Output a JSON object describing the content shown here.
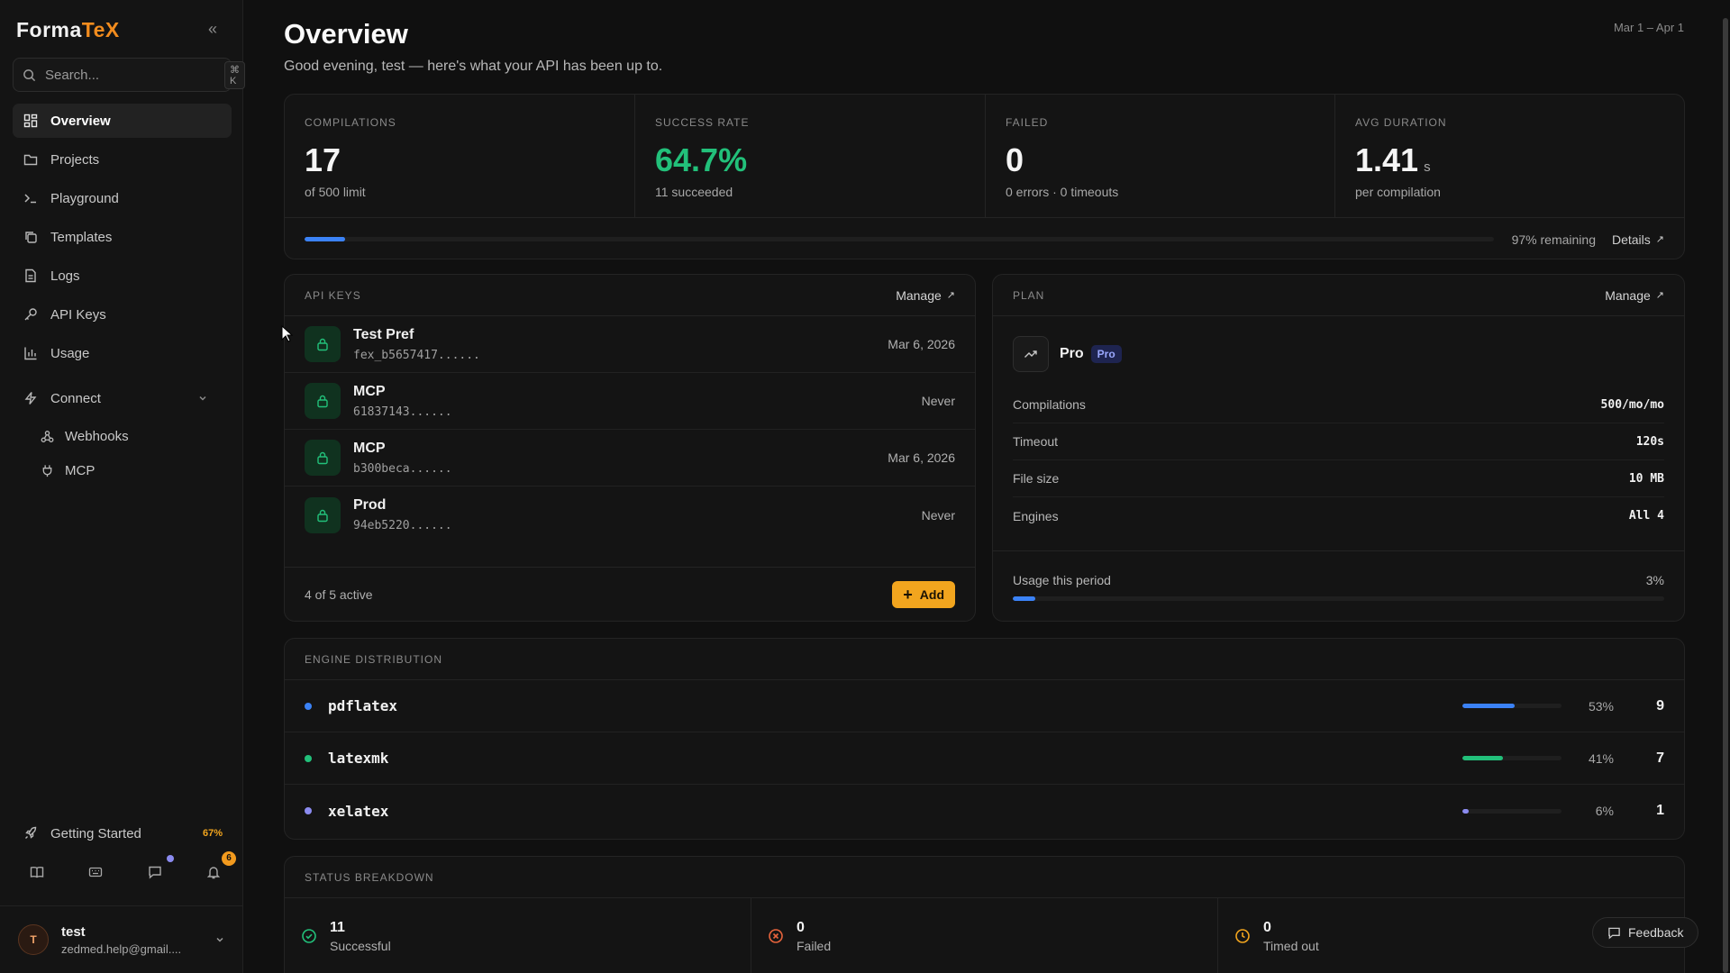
{
  "brand": {
    "name_main": "Forma",
    "name_accent": "TeX"
  },
  "sidebar": {
    "collapse_label": "«",
    "search_placeholder": "Search...",
    "search_shortcut": "⌘ K",
    "items": [
      {
        "label": "Overview",
        "icon": "grid-icon"
      },
      {
        "label": "Projects",
        "icon": "folder-icon"
      },
      {
        "label": "Playground",
        "icon": "terminal-icon"
      },
      {
        "label": "Templates",
        "icon": "copy-icon"
      },
      {
        "label": "Logs",
        "icon": "file-icon"
      },
      {
        "label": "API Keys",
        "icon": "key-icon"
      },
      {
        "label": "Usage",
        "icon": "chart-icon"
      }
    ],
    "connect": {
      "label": "Connect",
      "children": [
        {
          "label": "Webhooks",
          "icon": "webhook-icon"
        },
        {
          "label": "MCP",
          "icon": "plug-icon"
        }
      ]
    },
    "getting_started": {
      "label": "Getting Started",
      "progress": "67%"
    },
    "notifications_count": "6",
    "user": {
      "initial": "T",
      "name": "test",
      "email": "zedmed.help@gmail...."
    }
  },
  "header": {
    "title": "Overview",
    "greeting": "Good evening, test — here's what your API has been up to.",
    "date_range": "Mar 1 – Apr 1"
  },
  "stats": {
    "compilations": {
      "label": "COMPILATIONS",
      "value": "17",
      "sub": "of 500 limit"
    },
    "success_rate": {
      "label": "SUCCESS RATE",
      "value": "64.7%",
      "sub": "11 succeeded"
    },
    "failed": {
      "label": "FAILED",
      "value": "0",
      "sub": "0 errors · 0 timeouts"
    },
    "avg_duration": {
      "label": "AVG DURATION",
      "value": "1.41",
      "unit": "s",
      "sub": "per compilation"
    },
    "usage_progress": 0.034,
    "remaining": "97% remaining",
    "details_label": "Details"
  },
  "api_keys": {
    "label": "API KEYS",
    "manage_label": "Manage",
    "rows": [
      {
        "name": "Test Pref",
        "prefix": "fex_b5657417......",
        "date": "Mar 6, 2026"
      },
      {
        "name": "MCP",
        "prefix": "61837143......",
        "date": "Never"
      },
      {
        "name": "MCP",
        "prefix": "b300beca......",
        "date": "Mar 6, 2026"
      },
      {
        "name": "Prod",
        "prefix": "94eb5220......",
        "date": "Never"
      }
    ],
    "active_count": "4 of 5 active",
    "add_label": "Add"
  },
  "plan": {
    "label": "PLAN",
    "manage_label": "Manage",
    "name": "Pro",
    "badge": "Pro",
    "rows": [
      {
        "key": "Compilations",
        "value": "500/mo/mo"
      },
      {
        "key": "Timeout",
        "value": "120s"
      },
      {
        "key": "File size",
        "value": "10 MB"
      },
      {
        "key": "Engines",
        "value": "All 4"
      }
    ],
    "usage_label": "Usage this period",
    "usage_pct": "3%",
    "usage_progress": 0.034
  },
  "engines": {
    "label": "ENGINE DISTRIBUTION",
    "rows": [
      {
        "name": "pdflatex",
        "pct": "53%",
        "count": "9",
        "fraction": 0.53,
        "color": "#3b82f6"
      },
      {
        "name": "latexmk",
        "pct": "41%",
        "count": "7",
        "fraction": 0.41,
        "color": "#22c07a"
      },
      {
        "name": "xelatex",
        "pct": "6%",
        "count": "1",
        "fraction": 0.06,
        "color": "#8b8bf0"
      }
    ]
  },
  "status": {
    "label": "STATUS BREAKDOWN",
    "cells": [
      {
        "value": "11",
        "label": "Successful",
        "color": "#22c07a"
      },
      {
        "value": "0",
        "label": "Failed",
        "color": "#e8643c"
      },
      {
        "value": "0",
        "label": "Timed out",
        "color": "#f2a51e"
      }
    ]
  },
  "feedback_label": "Feedback",
  "colors": {
    "accent": "#f28c1e",
    "primary": "#3b82f6",
    "success": "#22c07a",
    "add_button": "#f2a51e"
  }
}
